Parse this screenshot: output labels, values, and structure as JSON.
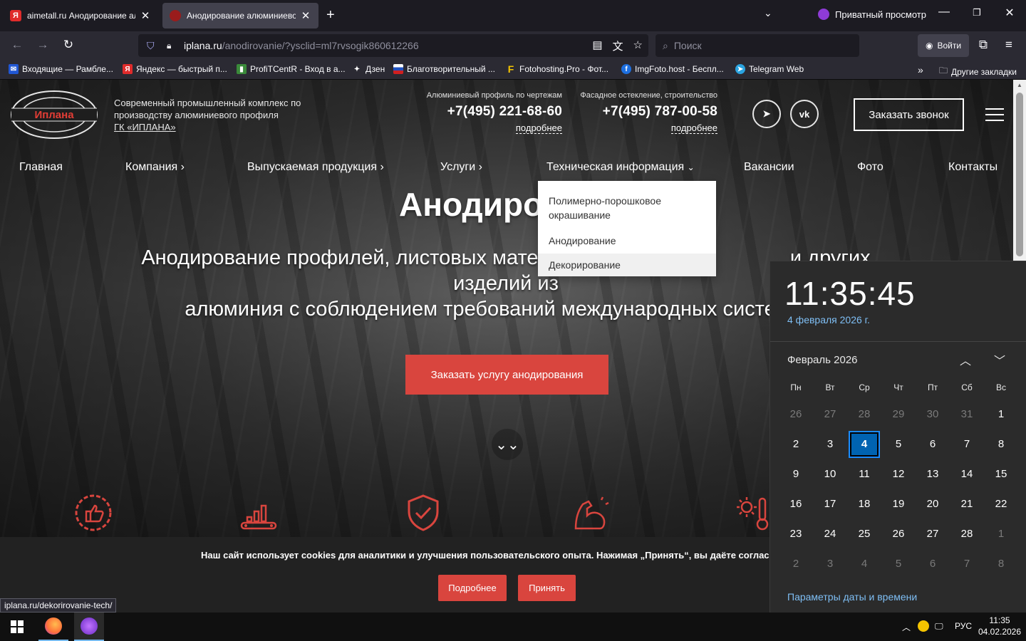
{
  "browser": {
    "tabs": [
      {
        "title": "aimetall.ru Анодирование алюм",
        "active": false
      },
      {
        "title": "Анодирование алюминиевого",
        "active": true
      }
    ],
    "private_label": "Приватный просмотр",
    "url_host": "iplana.ru",
    "url_path": "/anodirovanie/?ysclid=ml7rvsogik860612266",
    "search_placeholder": "Поиск",
    "login_label": "Войти",
    "bookmarks": [
      "Входящие — Рамбле...",
      "Яндекс — быстрый п...",
      "ProfiTCentR - Вход в а...",
      "Дзен",
      "Благотворительный ...",
      "Fotohosting.Pro - Фот...",
      "ImgFoto.host - Беспл...",
      "Telegram Web"
    ],
    "other_bookmarks": "Другие закладки",
    "status_url": "iplana.ru/dekorirovanie-tech/"
  },
  "site": {
    "logo_text": "Иплана",
    "tagline": "Современный промышленный комплекс по производству алюминиевого профиля",
    "tagline_link": "ГК «ИПЛАНА»",
    "phone1": {
      "caption": "Алюминиевый профиль по чертежам",
      "number": "+7(495) 221-68-60",
      "more": "подробнее"
    },
    "phone2": {
      "caption": "Фасадное остекление, строительство",
      "number": "+7(495) 787-00-58",
      "more": "подробнее"
    },
    "callback": "Заказать звонок",
    "menu": [
      "Главная",
      "Компания",
      "Выпускаемая продукция",
      "Услуги",
      "Техническая информация",
      "Вакансии",
      "Фото",
      "Контакты"
    ],
    "dropdown": [
      "Полимерно-порошковое окрашивание",
      "Анодирование",
      "Декорирование"
    ],
    "hero_title": "Анодиров",
    "hero_sub_line1": "Анодирование профилей, листовых материалов",
    "hero_sub_line1_end": "и других изделий из",
    "hero_sub_line2": "алюминия с соблюдением требований",
    "hero_sub_line2_end": "международных систем кач",
    "cta": "Заказать услугу анодирования",
    "cookie_text": "Наш сайт использует cookies для аналитики и улучшения пользовательского опыта. Нажимая „Принять“, вы даёте согласие на их испол",
    "cookie_more": "Подробнее",
    "cookie_accept": "Принять",
    "accent": "#d9453e"
  },
  "calendar": {
    "time": "11:35:45",
    "date": "4 февраля 2026 г.",
    "month": "Февраль 2026",
    "weekdays": [
      "Пн",
      "Вт",
      "Ср",
      "Чт",
      "Пт",
      "Сб",
      "Вс"
    ],
    "weeks": [
      [
        "26",
        "27",
        "28",
        "29",
        "30",
        "31",
        "1"
      ],
      [
        "2",
        "3",
        "4",
        "5",
        "6",
        "7",
        "8"
      ],
      [
        "9",
        "10",
        "11",
        "12",
        "13",
        "14",
        "15"
      ],
      [
        "16",
        "17",
        "18",
        "19",
        "20",
        "21",
        "22"
      ],
      [
        "23",
        "24",
        "25",
        "26",
        "27",
        "28",
        "1"
      ],
      [
        "2",
        "3",
        "4",
        "5",
        "6",
        "7",
        "8"
      ]
    ],
    "today": "4",
    "settings": "Параметры даты и времени"
  },
  "taskbar": {
    "lang": "РУС",
    "time": "11:35",
    "date": "04.02.2026"
  }
}
